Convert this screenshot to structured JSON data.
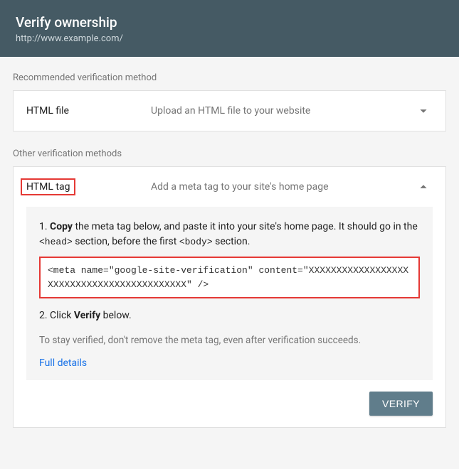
{
  "header": {
    "title": "Verify ownership",
    "url": "http://www.example.com/"
  },
  "recommended": {
    "section_label": "Recommended verification method",
    "method_title": "HTML file",
    "method_desc": "Upload an HTML file to your website"
  },
  "other": {
    "section_label": "Other verification methods",
    "method_title": "HTML tag",
    "method_desc": "Add a meta tag to your site's home page",
    "step1_prefix": "1. ",
    "step1_copy": "Copy",
    "step1_mid1": " the meta tag below, and paste it into your site's home page. It should go in the ",
    "step1_head": "<head>",
    "step1_mid2": " section, before the first ",
    "step1_body": "<body>",
    "step1_end": " section.",
    "meta_code": "<meta name=\"google-site-verification\" content=\"XXXXXXXXXXXXXXXXXXXXXXXXXXXXXXXXXXXXXXXXXXX\" />",
    "step2_prefix": "2. Click ",
    "step2_verify": "Verify",
    "step2_end": " below.",
    "caveat": "To stay verified, don't remove the meta tag, even after verification succeeds.",
    "full_details": "Full details",
    "verify_button": "VERIFY"
  }
}
